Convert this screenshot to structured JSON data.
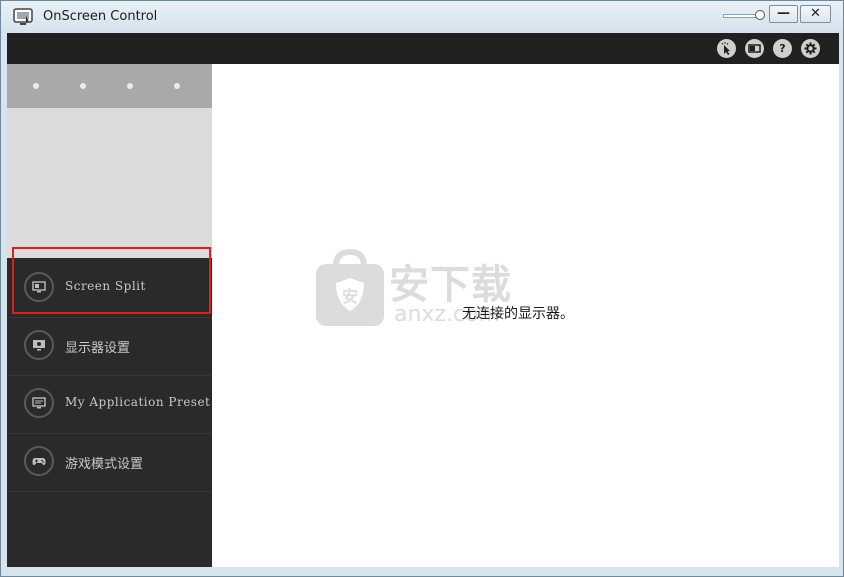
{
  "window": {
    "title": "OnScreen Control",
    "minimize_label": "—",
    "close_label": "✕"
  },
  "toolbar": {
    "icons": [
      "cursor-click-icon",
      "display-mode-icon",
      "help-icon",
      "settings-gear-icon"
    ],
    "help_label": "?"
  },
  "sidebar": {
    "carousel_dots": 4,
    "items": [
      {
        "label": "Screen Split",
        "icon": "monitor-split-icon"
      },
      {
        "label": "显示器设置",
        "icon": "monitor-settings-icon"
      },
      {
        "label": "My Application Preset",
        "icon": "app-preset-icon"
      },
      {
        "label": "游戏模式设置",
        "icon": "gamepad-icon"
      }
    ]
  },
  "main": {
    "status": "无连接的显示器。",
    "watermark": {
      "text": "安下载",
      "sub": "anxz.com"
    }
  },
  "colors": {
    "highlight": "#e01e1e",
    "sidebar_bg": "#2a2a2a",
    "toolbar_bg": "#202020"
  }
}
